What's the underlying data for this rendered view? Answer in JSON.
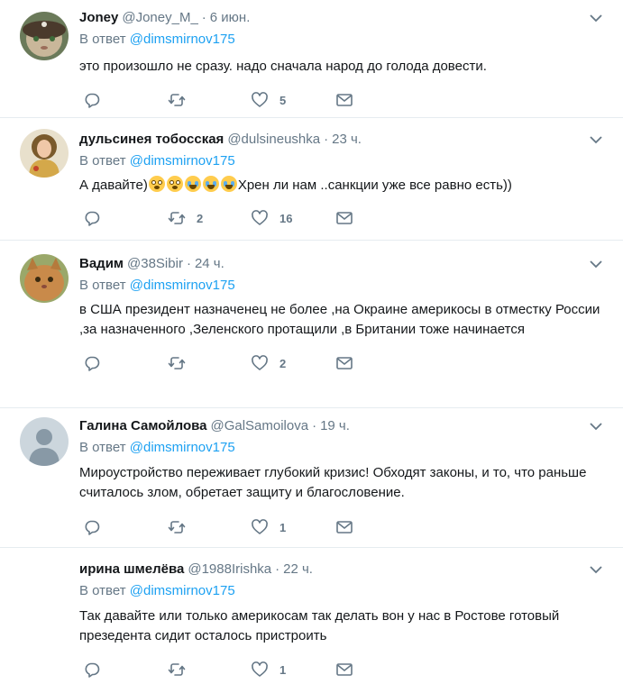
{
  "reply_prefix": "В ответ",
  "tweets": [
    {
      "name": "Joney",
      "handle": "@Joney_M_",
      "time": "6 июн.",
      "reply_to": "@dimsmirnov175",
      "text": "это произошло не сразу. надо сначала народ до голода довести.",
      "retweets": "",
      "likes": "5",
      "avatar": "cat-avatar"
    },
    {
      "name": "дульсинея тобосская",
      "handle": "@dulsineushka",
      "time": "23 ч.",
      "reply_to": "@dimsmirnov175",
      "text_before": "А давайте)",
      "emojis": [
        "flushed-face-icon",
        "flushed-face-icon",
        "tears-of-joy-icon",
        "tears-of-joy-icon",
        "tears-of-joy-icon"
      ],
      "text_after": "Хрен ли нам ..санкции уже все равно есть))",
      "retweets": "2",
      "likes": "16",
      "avatar": "woman-portrait-avatar"
    },
    {
      "name": "Вадим",
      "handle": "@38Sibir",
      "time": "24 ч.",
      "reply_to": "@dimsmirnov175",
      "text": "в США президент назначенец не более ,на Окраине америкосы в отместку России ,за назначенного  ,Зеленского протащили ,в Британии тоже начинается",
      "retweets": "",
      "likes": "2",
      "avatar": "cat-avatar"
    },
    {
      "name": "Галина Самойлова",
      "handle": "@GalSamoilova",
      "time": "19 ч.",
      "reply_to": "@dimsmirnov175",
      "text": "Мироустройство переживает глубокий кризис! Обходят законы, и то, что раньше считалось злом, обретает защиту и благословение.",
      "retweets": "",
      "likes": "1",
      "avatar": "default-avatar"
    },
    {
      "name": "ирина шмелёва",
      "handle": "@1988Irishka",
      "time": "22 ч.",
      "reply_to": "@dimsmirnov175",
      "text": "Так давайте или только америкосам так делать вон у нас в Ростове готовый презедента сидит осталось пристроить",
      "retweets": "",
      "likes": "1",
      "avatar": "none"
    }
  ],
  "colors": {
    "link": "#1da1f2",
    "muted": "#657786",
    "text": "#14171a",
    "divider": "#e6ecf0"
  }
}
